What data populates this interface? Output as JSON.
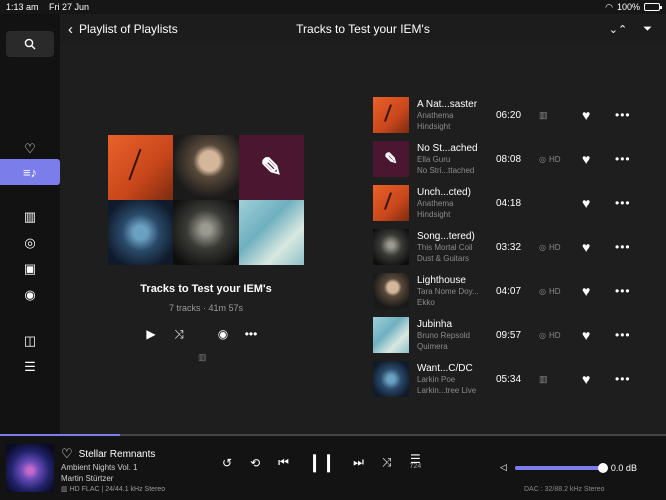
{
  "status_bar": {
    "time": "1:13 am",
    "date": "Fri 27 Jun",
    "battery": "100%"
  },
  "header": {
    "back_label": "Playlist of Playlists",
    "title": "Tracks to Test your IEM's"
  },
  "playlist": {
    "name": "Tracks to Test your IEM's",
    "meta": "7 tracks · 41m 57s"
  },
  "tracks": [
    {
      "title": "A Nat...saster",
      "artist": "Anathema",
      "album": "Hindsight",
      "duration": "06:20",
      "hd": ""
    },
    {
      "title": "No St...ached",
      "artist": "Ella Guru",
      "album": "No Stri...ttached",
      "duration": "08:08",
      "hd": "HD"
    },
    {
      "title": "Unch...cted)",
      "artist": "Anathema",
      "album": "Hindsight",
      "duration": "04:18",
      "hd": ""
    },
    {
      "title": "Song...tered)",
      "artist": "This Mortal Coil",
      "album": "Dust & Guitars",
      "duration": "03:32",
      "hd": "HD"
    },
    {
      "title": "Lighthouse",
      "artist": "Tara Nome Doy...",
      "album": "Ekko",
      "duration": "04:07",
      "hd": "HD"
    },
    {
      "title": "Jubinha",
      "artist": "Bruno Repsold",
      "album": "Quimera",
      "duration": "09:57",
      "hd": "HD"
    },
    {
      "title": "Want...C/DC",
      "artist": "Larkin Poe",
      "album": "Larkin...tree Live",
      "duration": "05:34",
      "hd": ""
    }
  ],
  "now_playing": {
    "title": "Stellar Remnants",
    "album": "Ambient Nights Vol. 1",
    "artist": "Martin Stürtzer",
    "format_hd": "HD",
    "format": "FLAC | 24/44.1 kHz Stereo",
    "queue_count": "724",
    "volume": "0.0 dB",
    "volume_level": 1.0,
    "progress": 0.18,
    "dac": "DAC : 32/88.2 kHz Stereo"
  },
  "colors": {
    "accent": "#7b7dea",
    "background": "#1c1c1c"
  }
}
